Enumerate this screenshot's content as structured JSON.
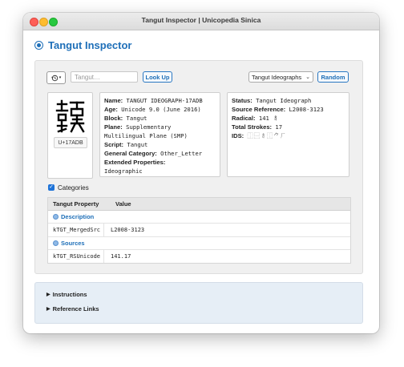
{
  "window": {
    "title": "Tangut Inspector | Unicopedia Sinica"
  },
  "app": {
    "title": "Tangut Inspector"
  },
  "toolbar": {
    "history_icon": "history-icon",
    "search_placeholder": "Tangut…",
    "lookup_label": "Look Up",
    "select_value": "Tangut Ideographs",
    "random_label": "Random"
  },
  "glyph": {
    "character": "𗫛",
    "codepoint": "U+17ADB"
  },
  "info_left": [
    {
      "key": "Name:",
      "value": "TANGUT IDEOGRAPH-17ADB"
    },
    {
      "key": "Age:",
      "value": "Unicode 9.0 (June 2016)"
    },
    {
      "key": "Block:",
      "value": "Tangut"
    },
    {
      "key": "Plane:",
      "value": "Supplementary Multilingual Plane (SMP)"
    },
    {
      "key": "Script:",
      "value": "Tangut"
    },
    {
      "key": "General Category:",
      "value": "Other_Letter"
    },
    {
      "key": "Extended Properties:",
      "value": "Ideographic"
    }
  ],
  "info_right": [
    {
      "key": "Status:",
      "value": "Tangut Ideograph"
    },
    {
      "key": "Source Reference:",
      "value": "L2008-3123"
    },
    {
      "key": "Radical:",
      "value": "141 𘤌"
    },
    {
      "key": "Total Strokes:",
      "value": "17"
    },
    {
      "key": "IDS:",
      "value": "⿰⿱𘤌⿰⺈𘠋"
    }
  ],
  "categories": {
    "label": "Categories",
    "checked": true
  },
  "table": {
    "headers": [
      "Tangut Property",
      "Value"
    ],
    "sections": [
      {
        "label": "Description",
        "rows": [
          {
            "property": "kTGT_MergedSrc",
            "value": "L2008-3123"
          }
        ]
      },
      {
        "label": "Sources",
        "rows": [
          {
            "property": "kTGT_RSUnicode",
            "value": "141.17"
          }
        ]
      }
    ]
  },
  "disclosures": [
    "Instructions",
    "Reference Links"
  ],
  "colors": {
    "accent": "#1e6fb8",
    "panel": "#f0f0f0",
    "bottom_panel": "#e6eef6"
  }
}
